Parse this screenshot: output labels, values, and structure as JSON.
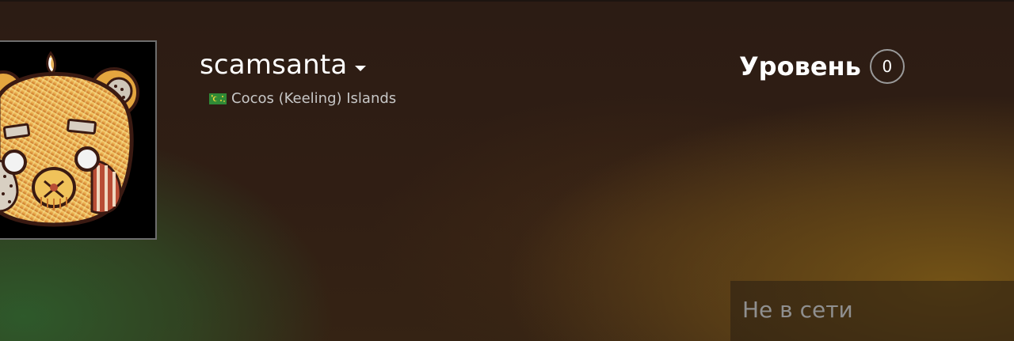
{
  "profile": {
    "persona_name": "scamsanta",
    "dropdown_icon": "caret-down-icon",
    "avatar_icon": "bear-mask-avatar",
    "location": {
      "flag_icon": "cocos-islands-flag-icon",
      "text": "Cocos (Keeling) Islands"
    },
    "level": {
      "label": "Уровень",
      "value": "0"
    },
    "status": {
      "text": "Не в сети"
    }
  },
  "colors": {
    "green_glow": "#2e5c2c",
    "gold_glow": "#7a5816",
    "base": "#2c1c14",
    "avatar_border": "#6d6d6d",
    "badge_border": "#9a9a9a",
    "status_text": "#8f8f8f"
  }
}
